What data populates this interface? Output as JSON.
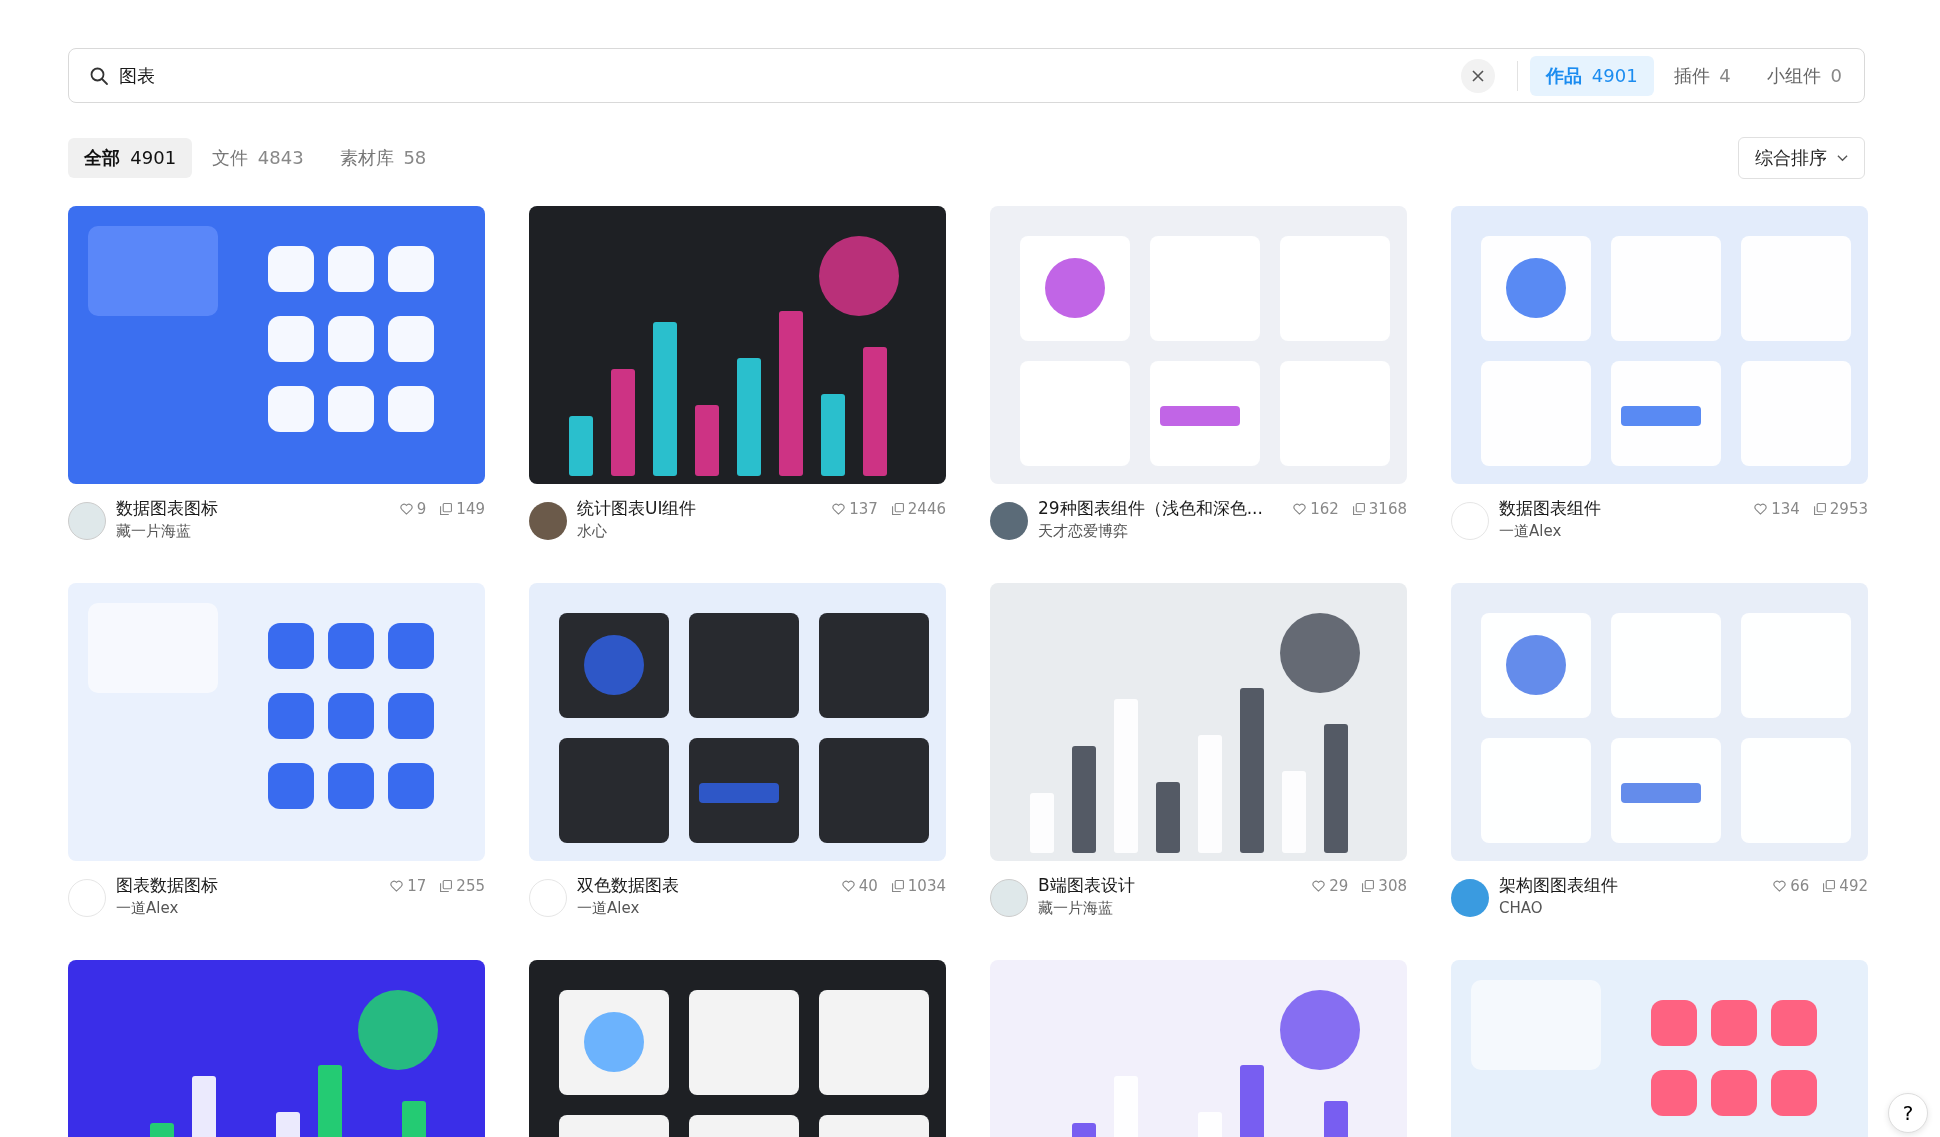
{
  "search": {
    "value": "图表"
  },
  "scopes": [
    {
      "label": "作品",
      "count": "4901",
      "selected": true
    },
    {
      "label": "插件",
      "count": "4",
      "selected": false
    },
    {
      "label": "小组件",
      "count": "0",
      "selected": false
    }
  ],
  "filters": [
    {
      "label": "全部",
      "count": "4901",
      "selected": true
    },
    {
      "label": "文件",
      "count": "4843",
      "selected": false
    },
    {
      "label": "素材库",
      "count": "58",
      "selected": false
    }
  ],
  "sort": {
    "label": "综合排序"
  },
  "cards": [
    {
      "kind": "picture",
      "title": "数据图表图标",
      "author": "藏一片海蓝",
      "likes": "9",
      "copies": "149"
    },
    {
      "kind": "picture",
      "title": "统计图表UI组件",
      "author": "水心",
      "likes": "137",
      "copies": "2446"
    },
    {
      "kind": "picture",
      "title": "29种图表组件（浅色和深色...",
      "author": "天才恋爱博弈",
      "likes": "162",
      "copies": "3168"
    },
    {
      "kind": "picture",
      "title": "数据图表组件",
      "author": "一道Alex",
      "likes": "134",
      "copies": "2953"
    },
    {
      "kind": "picture",
      "title": "图表数据图标",
      "author": "一道Alex",
      "likes": "17",
      "copies": "255"
    },
    {
      "kind": "picture",
      "title": "双色数据图表",
      "author": "一道Alex",
      "likes": "40",
      "copies": "1034"
    },
    {
      "kind": "picture",
      "title": "B端图表设计",
      "author": "藏一片海蓝",
      "likes": "29",
      "copies": "308"
    },
    {
      "kind": "picture",
      "title": "架构图图表组件",
      "author": "CHAO",
      "likes": "66",
      "copies": "492"
    },
    {
      "kind": "picture"
    },
    {
      "kind": "picture"
    },
    {
      "kind": "picture"
    },
    {
      "kind": "picture"
    }
  ],
  "help": {
    "label": "?"
  }
}
